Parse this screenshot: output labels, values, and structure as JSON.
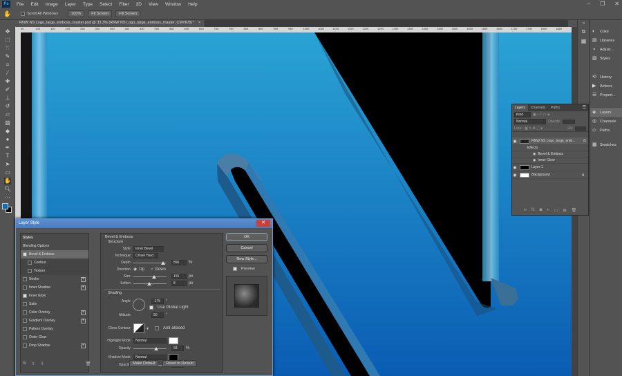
{
  "app": {
    "logo": "Ps"
  },
  "menu": [
    "File",
    "Edit",
    "Image",
    "Layer",
    "Type",
    "Select",
    "Filter",
    "3D",
    "View",
    "Window",
    "Help"
  ],
  "window_controls": {
    "minimize": "–",
    "restore": "❐",
    "close": "✕"
  },
  "options_bar": {
    "scroll_all": "Scroll All Windows",
    "zoom": "100%",
    "fit_screen": "Fit Screen",
    "fill_screen": "Fill Screen"
  },
  "document_tab": {
    "title": "RNW NS Logo_large_emboss_master.psd @ 33.3% (RNW NS Logo_large_emboss_master, CMYK/8) *",
    "close": "×"
  },
  "ruler_ticks": [
    "50",
    "100",
    "150",
    "200",
    "250",
    "300",
    "350",
    "400",
    "450",
    "500",
    "550",
    "600",
    "650",
    "700",
    "750",
    "800",
    "850",
    "900",
    "950",
    "1000",
    "1050",
    "1100",
    "1150",
    "1200",
    "1250",
    "1300",
    "1350",
    "1400",
    "1450",
    "1500",
    "1550",
    "1600",
    "1650",
    "1700",
    "1750",
    "1800",
    "1850"
  ],
  "right_panel": {
    "group1": [
      {
        "icon": "color-icon",
        "label": "Color"
      },
      {
        "icon": "libraries-icon",
        "label": "Libraries"
      },
      {
        "icon": "adjustments-icon",
        "label": "Adjust..."
      },
      {
        "icon": "styles-icon",
        "label": "Styles"
      }
    ],
    "group2": [
      {
        "icon": "history-icon",
        "label": "History"
      },
      {
        "icon": "actions-icon",
        "label": "Actions"
      },
      {
        "icon": "properties-icon",
        "label": "Propert..."
      }
    ],
    "group3": [
      {
        "icon": "layers-icon",
        "label": "Layers"
      },
      {
        "icon": "channels-icon",
        "label": "Channels"
      },
      {
        "icon": "paths-icon",
        "label": "Paths"
      }
    ],
    "group4": [
      {
        "icon": "swatches-icon",
        "label": "Swatches"
      }
    ]
  },
  "layers_panel": {
    "tabs": [
      "Layers",
      "Channels",
      "Paths"
    ],
    "kind_filter": "Kind",
    "blend_mode": "Normal",
    "opacity_label": "Opacity:",
    "lock_label": "Lock:",
    "fill_label": "Fill:",
    "layers": [
      {
        "name": "RNW NS Logo_large_emb...",
        "fx": "fx"
      },
      {
        "name": "Effects"
      },
      {
        "name": "Bevel & Emboss"
      },
      {
        "name": "Inner Glow"
      },
      {
        "name": "Layer 1"
      },
      {
        "name": "Background"
      }
    ]
  },
  "dialog": {
    "title": "Layer Style",
    "close": "✕",
    "styles": [
      {
        "label": "Styles",
        "checked": null,
        "plus": false,
        "selected": false,
        "sub": false
      },
      {
        "label": "Blending Options",
        "checked": null,
        "plus": false,
        "selected": false,
        "sub": false
      },
      {
        "label": "Bevel & Emboss",
        "checked": true,
        "plus": false,
        "selected": true,
        "sub": false
      },
      {
        "label": "Contour",
        "checked": false,
        "plus": false,
        "selected": false,
        "sub": true
      },
      {
        "label": "Texture",
        "checked": false,
        "plus": false,
        "selected": false,
        "sub": true
      },
      {
        "label": "Stroke",
        "checked": false,
        "plus": true,
        "selected": false,
        "sub": false
      },
      {
        "label": "Inner Shadow",
        "checked": false,
        "plus": true,
        "selected": false,
        "sub": false
      },
      {
        "label": "Inner Glow",
        "checked": true,
        "plus": false,
        "selected": false,
        "sub": false
      },
      {
        "label": "Satin",
        "checked": false,
        "plus": false,
        "selected": false,
        "sub": false
      },
      {
        "label": "Color Overlay",
        "checked": false,
        "plus": true,
        "selected": false,
        "sub": false
      },
      {
        "label": "Gradient Overlay",
        "checked": false,
        "plus": true,
        "selected": false,
        "sub": false
      },
      {
        "label": "Pattern Overlay",
        "checked": false,
        "plus": false,
        "selected": false,
        "sub": false
      },
      {
        "label": "Outer Glow",
        "checked": false,
        "plus": false,
        "selected": false,
        "sub": false
      },
      {
        "label": "Drop Shadow",
        "checked": false,
        "plus": true,
        "selected": false,
        "sub": false
      }
    ],
    "footer_fx": "fx",
    "bevel": {
      "section": "Bevel & Emboss",
      "subsection": "Structure",
      "style_label": "Style:",
      "style_value": "Inner Bevel",
      "technique_label": "Technique:",
      "technique_value": "Chisel Hard",
      "depth_label": "Depth:",
      "depth_value": "896",
      "depth_unit": "%",
      "depth_fraction": 0.9,
      "direction_label": "Direction:",
      "direction_up": "Up",
      "direction_down": "Down",
      "size_label": "Size:",
      "size_value": "155",
      "size_unit": "px",
      "size_fraction": 0.62,
      "soften_label": "Soften:",
      "soften_value": "8",
      "soften_unit": "px",
      "soften_fraction": 0.48,
      "shading": "Shading",
      "angle_label": "Angle:",
      "angle_value": "-175",
      "angle_unit": "°",
      "global_light": "Use Global Light",
      "altitude_label": "Altitude:",
      "altitude_value": "50",
      "altitude_unit": "°",
      "gloss_label": "Gloss Contour:",
      "anti_aliased": "Anti-aliased",
      "highlight_label": "Highlight Mode:",
      "highlight_value": "Normal",
      "highlight_color": "#ffffff",
      "hl_opacity_label": "Opacity:",
      "hl_opacity_value": "68",
      "hl_opacity_unit": "%",
      "hl_opacity_fraction": 0.68,
      "shadow_label": "Shadow Mode:",
      "shadow_value": "Normal",
      "shadow_color": "#000000",
      "sh_opacity_label": "Opacity:",
      "sh_opacity_value": "50",
      "sh_opacity_unit": "%",
      "sh_opacity_fraction": 0.5,
      "make_default": "Make Default",
      "reset_default": "Reset to Default"
    },
    "buttons": {
      "ok": "OK",
      "cancel": "Cancel",
      "new_style": "New Style...",
      "preview": "Preview"
    }
  },
  "colors": {
    "accent": "#31a8ff",
    "canvas_top": "#2a9fd0",
    "canvas_bottom": "#0a5fb5"
  }
}
